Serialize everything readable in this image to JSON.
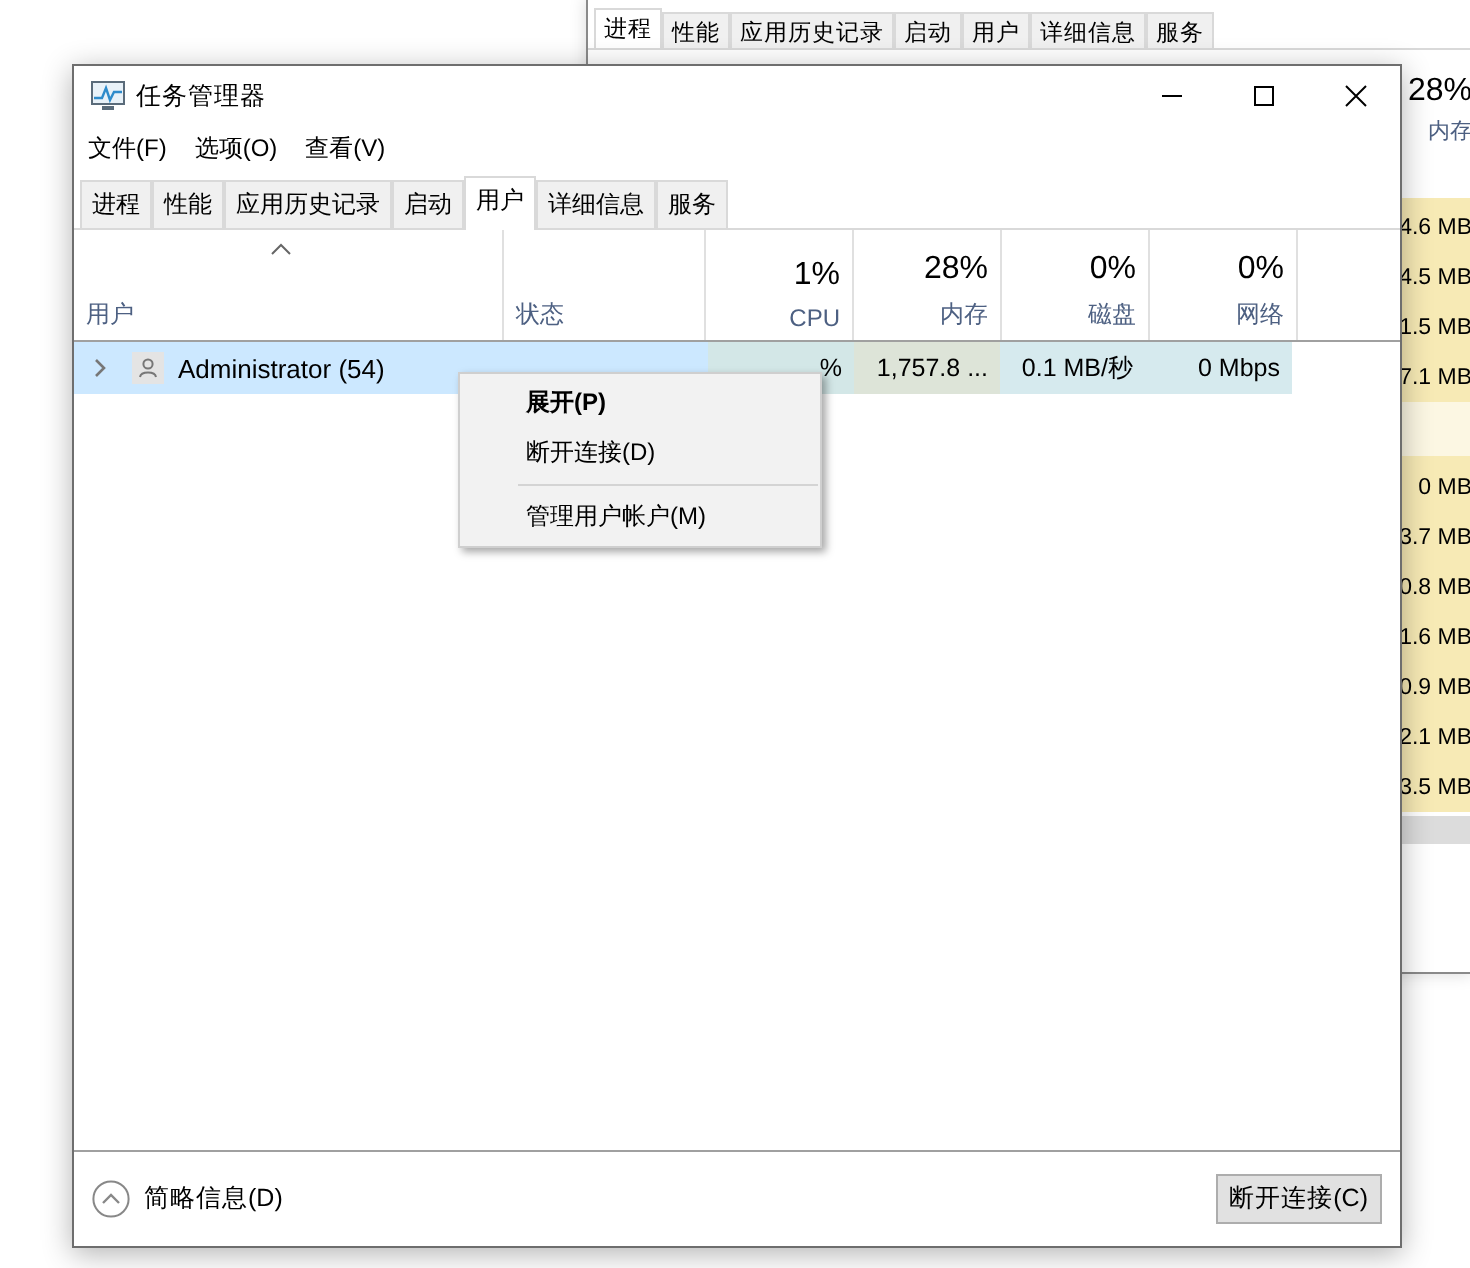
{
  "background_window": {
    "tabs": [
      {
        "label": "进程",
        "selected": true
      },
      {
        "label": "性能",
        "selected": false
      },
      {
        "label": "应用历史记录",
        "selected": false
      },
      {
        "label": "启动",
        "selected": false
      },
      {
        "label": "用户",
        "selected": false
      },
      {
        "label": "详细信息",
        "selected": false
      },
      {
        "label": "服务",
        "selected": false
      }
    ],
    "memory_column": {
      "percent": "28%",
      "label": "内存"
    },
    "memory_values": [
      {
        "kind": "value",
        "text": "4.6 MB"
      },
      {
        "kind": "value",
        "text": "4.5 MB"
      },
      {
        "kind": "value",
        "text": "1.5 MB"
      },
      {
        "kind": "value",
        "text": "7.1 MB"
      },
      {
        "kind": "group"
      },
      {
        "kind": "value",
        "text": "0 MB"
      },
      {
        "kind": "value",
        "text": "3.7 MB"
      },
      {
        "kind": "value",
        "text": "0.8 MB"
      },
      {
        "kind": "value",
        "text": "1.6 MB"
      },
      {
        "kind": "value",
        "text": "0.9 MB"
      },
      {
        "kind": "value",
        "text": "2.1 MB"
      },
      {
        "kind": "value",
        "text": "3.5 MB"
      }
    ]
  },
  "window": {
    "title": "任务管理器"
  },
  "menu": [
    "文件(F)",
    "选项(O)",
    "查看(V)"
  ],
  "tabs": [
    {
      "label": "进程",
      "selected": false
    },
    {
      "label": "性能",
      "selected": false
    },
    {
      "label": "应用历史记录",
      "selected": false
    },
    {
      "label": "启动",
      "selected": false
    },
    {
      "label": "用户",
      "selected": true
    },
    {
      "label": "详细信息",
      "selected": false
    },
    {
      "label": "服务",
      "selected": false
    }
  ],
  "table": {
    "columns": [
      {
        "name": "用户",
        "sorted": true
      },
      {
        "name": "状态",
        "sorted": false
      },
      {
        "percent": "1%",
        "name": "CPU",
        "sorted": false
      },
      {
        "percent": "28%",
        "name": "内存",
        "sorted": false
      },
      {
        "percent": "0%",
        "name": "磁盘",
        "sorted": false
      },
      {
        "percent": "0%",
        "name": "网络",
        "sorted": false
      }
    ],
    "rows": [
      {
        "expanded": false,
        "selected": true,
        "cells": [
          "Administrator (54)",
          "",
          "%",
          "1,757.8 ...",
          "0.1 MB/秒",
          "0 Mbps"
        ]
      }
    ]
  },
  "context_menu": [
    {
      "kind": "item",
      "label": "展开(P)",
      "default": true
    },
    {
      "kind": "item",
      "label": "断开连接(D)",
      "default": false
    },
    {
      "kind": "separator"
    },
    {
      "kind": "item",
      "label": "管理用户帐户(M)",
      "default": false
    }
  ],
  "footer": {
    "details_toggle": "简略信息(D)",
    "button": "断开连接(C)"
  }
}
